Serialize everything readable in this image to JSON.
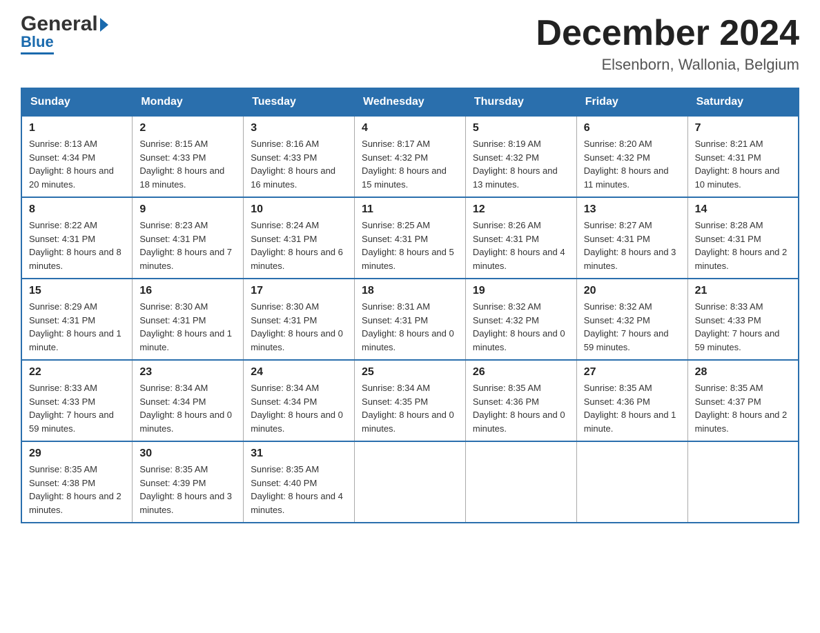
{
  "header": {
    "logo_general": "General",
    "logo_blue": "Blue",
    "month_title": "December 2024",
    "location": "Elsenborn, Wallonia, Belgium"
  },
  "days_of_week": [
    "Sunday",
    "Monday",
    "Tuesday",
    "Wednesday",
    "Thursday",
    "Friday",
    "Saturday"
  ],
  "weeks": [
    [
      {
        "day": "1",
        "sunrise": "8:13 AM",
        "sunset": "4:34 PM",
        "daylight": "8 hours and 20 minutes."
      },
      {
        "day": "2",
        "sunrise": "8:15 AM",
        "sunset": "4:33 PM",
        "daylight": "8 hours and 18 minutes."
      },
      {
        "day": "3",
        "sunrise": "8:16 AM",
        "sunset": "4:33 PM",
        "daylight": "8 hours and 16 minutes."
      },
      {
        "day": "4",
        "sunrise": "8:17 AM",
        "sunset": "4:32 PM",
        "daylight": "8 hours and 15 minutes."
      },
      {
        "day": "5",
        "sunrise": "8:19 AM",
        "sunset": "4:32 PM",
        "daylight": "8 hours and 13 minutes."
      },
      {
        "day": "6",
        "sunrise": "8:20 AM",
        "sunset": "4:32 PM",
        "daylight": "8 hours and 11 minutes."
      },
      {
        "day": "7",
        "sunrise": "8:21 AM",
        "sunset": "4:31 PM",
        "daylight": "8 hours and 10 minutes."
      }
    ],
    [
      {
        "day": "8",
        "sunrise": "8:22 AM",
        "sunset": "4:31 PM",
        "daylight": "8 hours and 8 minutes."
      },
      {
        "day": "9",
        "sunrise": "8:23 AM",
        "sunset": "4:31 PM",
        "daylight": "8 hours and 7 minutes."
      },
      {
        "day": "10",
        "sunrise": "8:24 AM",
        "sunset": "4:31 PM",
        "daylight": "8 hours and 6 minutes."
      },
      {
        "day": "11",
        "sunrise": "8:25 AM",
        "sunset": "4:31 PM",
        "daylight": "8 hours and 5 minutes."
      },
      {
        "day": "12",
        "sunrise": "8:26 AM",
        "sunset": "4:31 PM",
        "daylight": "8 hours and 4 minutes."
      },
      {
        "day": "13",
        "sunrise": "8:27 AM",
        "sunset": "4:31 PM",
        "daylight": "8 hours and 3 minutes."
      },
      {
        "day": "14",
        "sunrise": "8:28 AM",
        "sunset": "4:31 PM",
        "daylight": "8 hours and 2 minutes."
      }
    ],
    [
      {
        "day": "15",
        "sunrise": "8:29 AM",
        "sunset": "4:31 PM",
        "daylight": "8 hours and 1 minute."
      },
      {
        "day": "16",
        "sunrise": "8:30 AM",
        "sunset": "4:31 PM",
        "daylight": "8 hours and 1 minute."
      },
      {
        "day": "17",
        "sunrise": "8:30 AM",
        "sunset": "4:31 PM",
        "daylight": "8 hours and 0 minutes."
      },
      {
        "day": "18",
        "sunrise": "8:31 AM",
        "sunset": "4:31 PM",
        "daylight": "8 hours and 0 minutes."
      },
      {
        "day": "19",
        "sunrise": "8:32 AM",
        "sunset": "4:32 PM",
        "daylight": "8 hours and 0 minutes."
      },
      {
        "day": "20",
        "sunrise": "8:32 AM",
        "sunset": "4:32 PM",
        "daylight": "7 hours and 59 minutes."
      },
      {
        "day": "21",
        "sunrise": "8:33 AM",
        "sunset": "4:33 PM",
        "daylight": "7 hours and 59 minutes."
      }
    ],
    [
      {
        "day": "22",
        "sunrise": "8:33 AM",
        "sunset": "4:33 PM",
        "daylight": "7 hours and 59 minutes."
      },
      {
        "day": "23",
        "sunrise": "8:34 AM",
        "sunset": "4:34 PM",
        "daylight": "8 hours and 0 minutes."
      },
      {
        "day": "24",
        "sunrise": "8:34 AM",
        "sunset": "4:34 PM",
        "daylight": "8 hours and 0 minutes."
      },
      {
        "day": "25",
        "sunrise": "8:34 AM",
        "sunset": "4:35 PM",
        "daylight": "8 hours and 0 minutes."
      },
      {
        "day": "26",
        "sunrise": "8:35 AM",
        "sunset": "4:36 PM",
        "daylight": "8 hours and 0 minutes."
      },
      {
        "day": "27",
        "sunrise": "8:35 AM",
        "sunset": "4:36 PM",
        "daylight": "8 hours and 1 minute."
      },
      {
        "day": "28",
        "sunrise": "8:35 AM",
        "sunset": "4:37 PM",
        "daylight": "8 hours and 2 minutes."
      }
    ],
    [
      {
        "day": "29",
        "sunrise": "8:35 AM",
        "sunset": "4:38 PM",
        "daylight": "8 hours and 2 minutes."
      },
      {
        "day": "30",
        "sunrise": "8:35 AM",
        "sunset": "4:39 PM",
        "daylight": "8 hours and 3 minutes."
      },
      {
        "day": "31",
        "sunrise": "8:35 AM",
        "sunset": "4:40 PM",
        "daylight": "8 hours and 4 minutes."
      },
      null,
      null,
      null,
      null
    ]
  ],
  "labels": {
    "sunrise": "Sunrise:",
    "sunset": "Sunset:",
    "daylight": "Daylight:"
  }
}
